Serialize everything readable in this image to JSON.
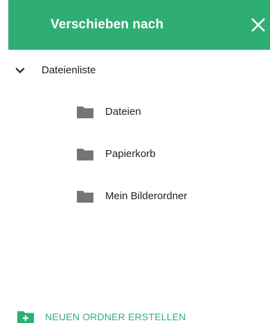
{
  "dialog": {
    "title": "Verschieben nach",
    "close_icon": "close-icon",
    "accent_color": "#2fae73"
  },
  "tree": {
    "root": {
      "label": "Dateienliste",
      "expanded": true,
      "icon": "chevron-down-icon"
    },
    "folders": [
      {
        "label": "Dateien",
        "icon": "folder-icon"
      },
      {
        "label": "Papierkorb",
        "icon": "folder-icon"
      },
      {
        "label": "Mein Bilderordner",
        "icon": "folder-icon"
      }
    ]
  },
  "actions": {
    "new_folder_label": "NEUEN ORDNER ERSTELLEN",
    "new_folder_icon": "folder-plus-icon"
  }
}
